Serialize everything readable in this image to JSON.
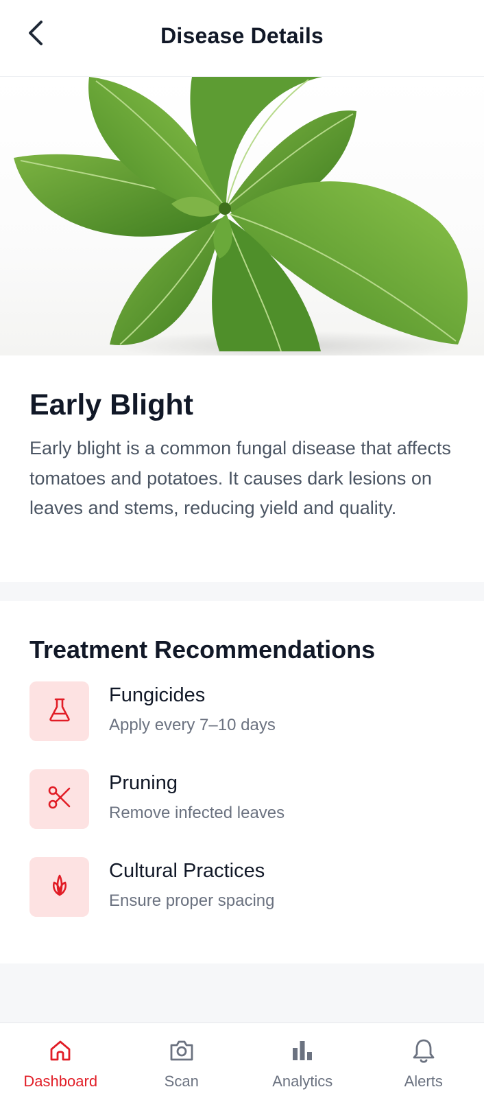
{
  "header": {
    "title": "Disease Details",
    "back_icon": "chevron-left-icon"
  },
  "disease": {
    "name": "Early Blight",
    "description": "Early blight is a common fungal disease that affects tomatoes and potatoes. It causes dark lesions on leaves and stems, reducing yield and quality."
  },
  "treatment": {
    "title": "Treatment Recommendations",
    "items": [
      {
        "title": "Fungicides",
        "subtitle": "Apply every 7–10 days",
        "icon": "flask-icon"
      },
      {
        "title": "Pruning",
        "subtitle": "Remove infected leaves",
        "icon": "scissors-icon"
      },
      {
        "title": "Cultural Practices",
        "subtitle": "Ensure proper spacing",
        "icon": "sprout-icon"
      }
    ]
  },
  "nav": {
    "items": [
      {
        "label": "Dashboard",
        "icon": "home-icon",
        "active": true
      },
      {
        "label": "Scan",
        "icon": "camera-icon",
        "active": false
      },
      {
        "label": "Analytics",
        "icon": "bar-chart-icon",
        "active": false
      },
      {
        "label": "Alerts",
        "icon": "bell-icon",
        "active": false
      }
    ]
  },
  "colors": {
    "accent": "#e11d26",
    "accent_soft": "#fde2e2",
    "text_primary": "#111827",
    "text_secondary": "#6b7280",
    "leaf": "#5a9a2e"
  }
}
